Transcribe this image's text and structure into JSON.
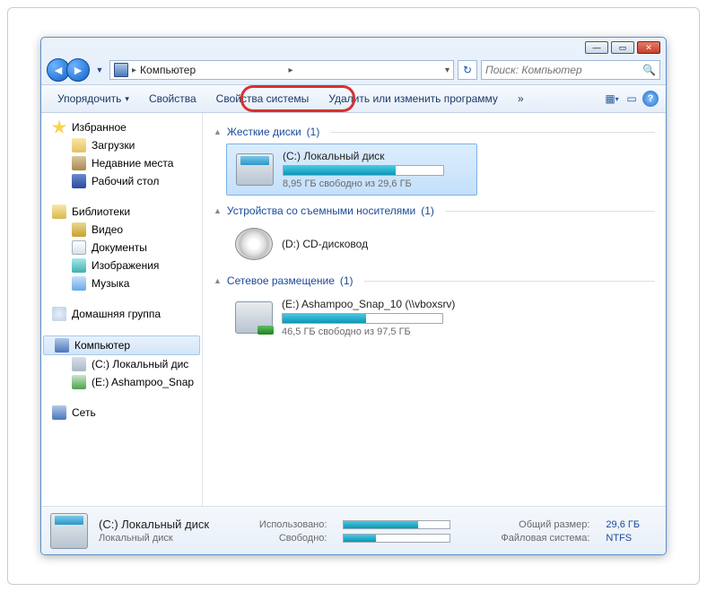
{
  "titlebar": {
    "min": "—",
    "max": "▭",
    "close": "✕"
  },
  "nav": {
    "back": "◄",
    "fwd": "►",
    "dd": "▼",
    "path": "Компьютер",
    "chev": "▸",
    "chev2": "▾",
    "refresh": "↻",
    "search_placeholder": "Поиск: Компьютер",
    "mag": "🔍"
  },
  "toolbar": {
    "organize": "Упорядочить",
    "dd": "▾",
    "props": "Свойства",
    "sysprops": "Свойства системы",
    "uninstall": "Удалить или изменить программу",
    "more": "»",
    "view1": "▦",
    "view2": "▭",
    "help": "?"
  },
  "sidebar": {
    "fav": "Избранное",
    "fav_items": [
      {
        "label": "Загрузки",
        "icon": "ico-dl"
      },
      {
        "label": "Недавние места",
        "icon": "ico-recent"
      },
      {
        "label": "Рабочий стол",
        "icon": "ico-desk"
      }
    ],
    "lib": "Библиотеки",
    "lib_items": [
      {
        "label": "Видео",
        "icon": "ico-vid"
      },
      {
        "label": "Документы",
        "icon": "ico-doc"
      },
      {
        "label": "Изображения",
        "icon": "ico-img"
      },
      {
        "label": "Музыка",
        "icon": "ico-mus"
      }
    ],
    "homegroup": "Домашняя группа",
    "computer": "Компьютер",
    "comp_items": [
      {
        "label": "(C:) Локальный дис",
        "icon": "ico-drive"
      },
      {
        "label": "(E:) Ashampoo_Snap",
        "icon": "ico-net"
      }
    ],
    "network": "Сеть"
  },
  "content": {
    "sec_hdd": "Жесткие диски",
    "sec_hdd_n": "(1)",
    "drive_c": {
      "name": "(C:) Локальный диск",
      "free": "8,95 ГБ свободно из 29,6 ГБ",
      "pct": 70
    },
    "sec_rem": "Устройства со съемными носителями",
    "sec_rem_n": "(1)",
    "drive_d": {
      "name": "(D:) CD-дисковод"
    },
    "sec_net": "Сетевое размещение",
    "sec_net_n": "(1)",
    "drive_e": {
      "name": "(E:) Ashampoo_Snap_10 (\\\\vboxsrv)",
      "free": "46,5 ГБ свободно из 97,5 ГБ",
      "pct": 52
    }
  },
  "details": {
    "title": "(C:) Локальный диск",
    "subtitle": "Локальный диск",
    "used_lbl": "Использовано:",
    "free_lbl": "Свободно:",
    "total_lbl": "Общий размер:",
    "fs_lbl": "Файловая система:",
    "total": "29,6 ГБ",
    "fs": "NTFS",
    "used_pct": 70,
    "free_pct": 30
  }
}
